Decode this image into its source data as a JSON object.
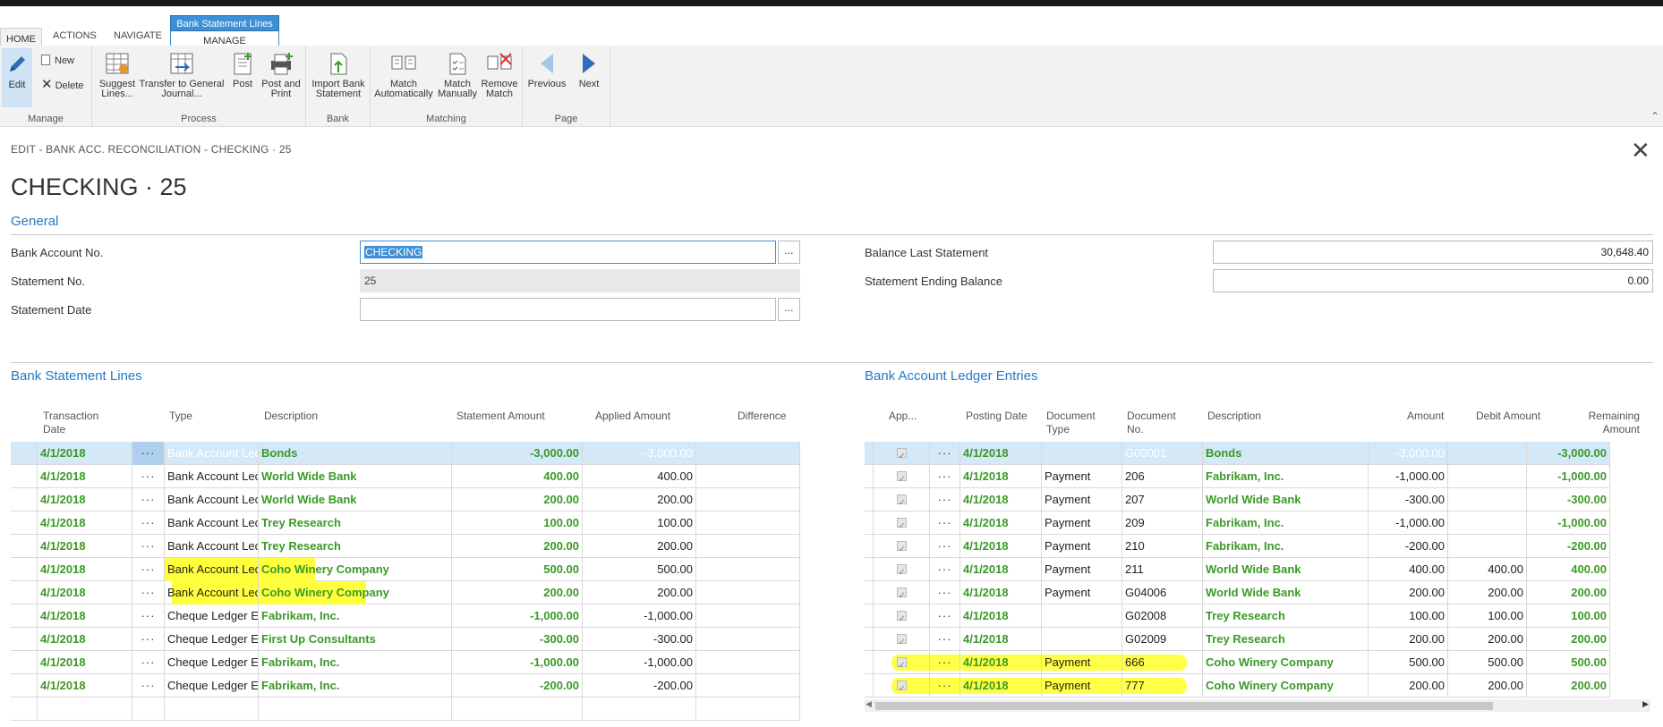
{
  "ribbon": {
    "tabs": [
      "HOME",
      "ACTIONS",
      "NAVIGATE"
    ],
    "context_group": "Bank Statement Lines",
    "context_tab": "MANAGE",
    "groups": {
      "manage": {
        "label": "Manage",
        "edit": "Edit",
        "new": "New",
        "delete": "Delete"
      },
      "process": {
        "label": "Process",
        "suggest": "Suggest Lines...",
        "transfer": "Transfer to General Journal...",
        "post": "Post",
        "post_print": "Post and Print"
      },
      "bank": {
        "label": "Bank",
        "import": "Import Bank Statement"
      },
      "matching": {
        "label": "Matching",
        "match_auto": "Match Automatically",
        "match_manual": "Match Manually",
        "remove_match": "Remove Match"
      },
      "page": {
        "label": "Page",
        "previous": "Previous",
        "next": "Next"
      }
    }
  },
  "header": {
    "breadcrumb": "EDIT - BANK ACC. RECONCILIATION - CHECKING · 25",
    "title": "CHECKING · 25"
  },
  "general": {
    "title": "General",
    "bank_account_no_label": "Bank Account No.",
    "bank_account_no": "CHECKING",
    "statement_no_label": "Statement No.",
    "statement_no": "25",
    "statement_date_label": "Statement Date",
    "statement_date": "",
    "balance_last_label": "Balance Last Statement",
    "balance_last": "30,648.40",
    "ending_balance_label": "Statement Ending Balance",
    "ending_balance": "0.00",
    "lookup": "..."
  },
  "statement_lines": {
    "title": "Bank Statement Lines",
    "columns": [
      "Transaction Date",
      "Type",
      "Description",
      "Statement Amount",
      "Applied Amount",
      "Difference"
    ],
    "rows": [
      {
        "date": "4/1/2018",
        "type": "Bank Account Lec",
        "desc": "Bonds",
        "stmt": "-3,000.00",
        "applied": "-3,000.00",
        "diff": ""
      },
      {
        "date": "4/1/2018",
        "type": "Bank Account Lec",
        "desc": "World Wide Bank",
        "stmt": "400.00",
        "applied": "400.00",
        "diff": ""
      },
      {
        "date": "4/1/2018",
        "type": "Bank Account Lec",
        "desc": "World Wide Bank",
        "stmt": "200.00",
        "applied": "200.00",
        "diff": ""
      },
      {
        "date": "4/1/2018",
        "type": "Bank Account Lec",
        "desc": "Trey Research",
        "stmt": "100.00",
        "applied": "100.00",
        "diff": ""
      },
      {
        "date": "4/1/2018",
        "type": "Bank Account Lec",
        "desc": "Trey Research",
        "stmt": "200.00",
        "applied": "200.00",
        "diff": ""
      },
      {
        "date": "4/1/2018",
        "type": "Bank Account Lec",
        "desc": "Coho Winery Company",
        "stmt": "500.00",
        "applied": "500.00",
        "diff": ""
      },
      {
        "date": "4/1/2018",
        "type": "Bank Account Lec",
        "desc": "Coho Winery Company",
        "stmt": "200.00",
        "applied": "200.00",
        "diff": ""
      },
      {
        "date": "4/1/2018",
        "type": "Cheque Ledger E",
        "desc": "Fabrikam, Inc.",
        "stmt": "-1,000.00",
        "applied": "-1,000.00",
        "diff": ""
      },
      {
        "date": "4/1/2018",
        "type": "Cheque Ledger E",
        "desc": "First Up Consultants",
        "stmt": "-300.00",
        "applied": "-300.00",
        "diff": ""
      },
      {
        "date": "4/1/2018",
        "type": "Cheque Ledger E",
        "desc": "Fabrikam, Inc.",
        "stmt": "-1,000.00",
        "applied": "-1,000.00",
        "diff": ""
      },
      {
        "date": "4/1/2018",
        "type": "Cheque Ledger E",
        "desc": "Fabrikam, Inc.",
        "stmt": "-200.00",
        "applied": "-200.00",
        "diff": ""
      }
    ]
  },
  "ledger_entries": {
    "title": "Bank Account Ledger Entries",
    "columns": [
      "App...",
      "Posting Date",
      "Document Type",
      "Document No.",
      "Description",
      "Amount",
      "Debit Amount",
      "Remaining Amount"
    ],
    "rows": [
      {
        "date": "4/1/2018",
        "doctype": "",
        "docno": "G00001",
        "desc": "Bonds",
        "amount": "-3,000.00",
        "debit": "",
        "remaining": "-3,000.00"
      },
      {
        "date": "4/1/2018",
        "doctype": "Payment",
        "docno": "206",
        "desc": "Fabrikam, Inc.",
        "amount": "-1,000.00",
        "debit": "",
        "remaining": "-1,000.00"
      },
      {
        "date": "4/1/2018",
        "doctype": "Payment",
        "docno": "207",
        "desc": "World Wide Bank",
        "amount": "-300.00",
        "debit": "",
        "remaining": "-300.00"
      },
      {
        "date": "4/1/2018",
        "doctype": "Payment",
        "docno": "209",
        "desc": "Fabrikam, Inc.",
        "amount": "-1,000.00",
        "debit": "",
        "remaining": "-1,000.00"
      },
      {
        "date": "4/1/2018",
        "doctype": "Payment",
        "docno": "210",
        "desc": "Fabrikam, Inc.",
        "amount": "-200.00",
        "debit": "",
        "remaining": "-200.00"
      },
      {
        "date": "4/1/2018",
        "doctype": "Payment",
        "docno": "211",
        "desc": "World Wide Bank",
        "amount": "400.00",
        "debit": "400.00",
        "remaining": "400.00"
      },
      {
        "date": "4/1/2018",
        "doctype": "Payment",
        "docno": "G04006",
        "desc": "World Wide Bank",
        "amount": "200.00",
        "debit": "200.00",
        "remaining": "200.00"
      },
      {
        "date": "4/1/2018",
        "doctype": "",
        "docno": "G02008",
        "desc": "Trey Research",
        "amount": "100.00",
        "debit": "100.00",
        "remaining": "100.00"
      },
      {
        "date": "4/1/2018",
        "doctype": "",
        "docno": "G02009",
        "desc": "Trey Research",
        "amount": "200.00",
        "debit": "200.00",
        "remaining": "200.00"
      },
      {
        "date": "4/1/2018",
        "doctype": "Payment",
        "docno": "666",
        "desc": "Coho Winery Company",
        "amount": "500.00",
        "debit": "500.00",
        "remaining": "500.00"
      },
      {
        "date": "4/1/2018",
        "doctype": "Payment",
        "docno": "777",
        "desc": "Coho Winery Company",
        "amount": "200.00",
        "debit": "200.00",
        "remaining": "200.00"
      }
    ]
  },
  "row_menu": "···"
}
